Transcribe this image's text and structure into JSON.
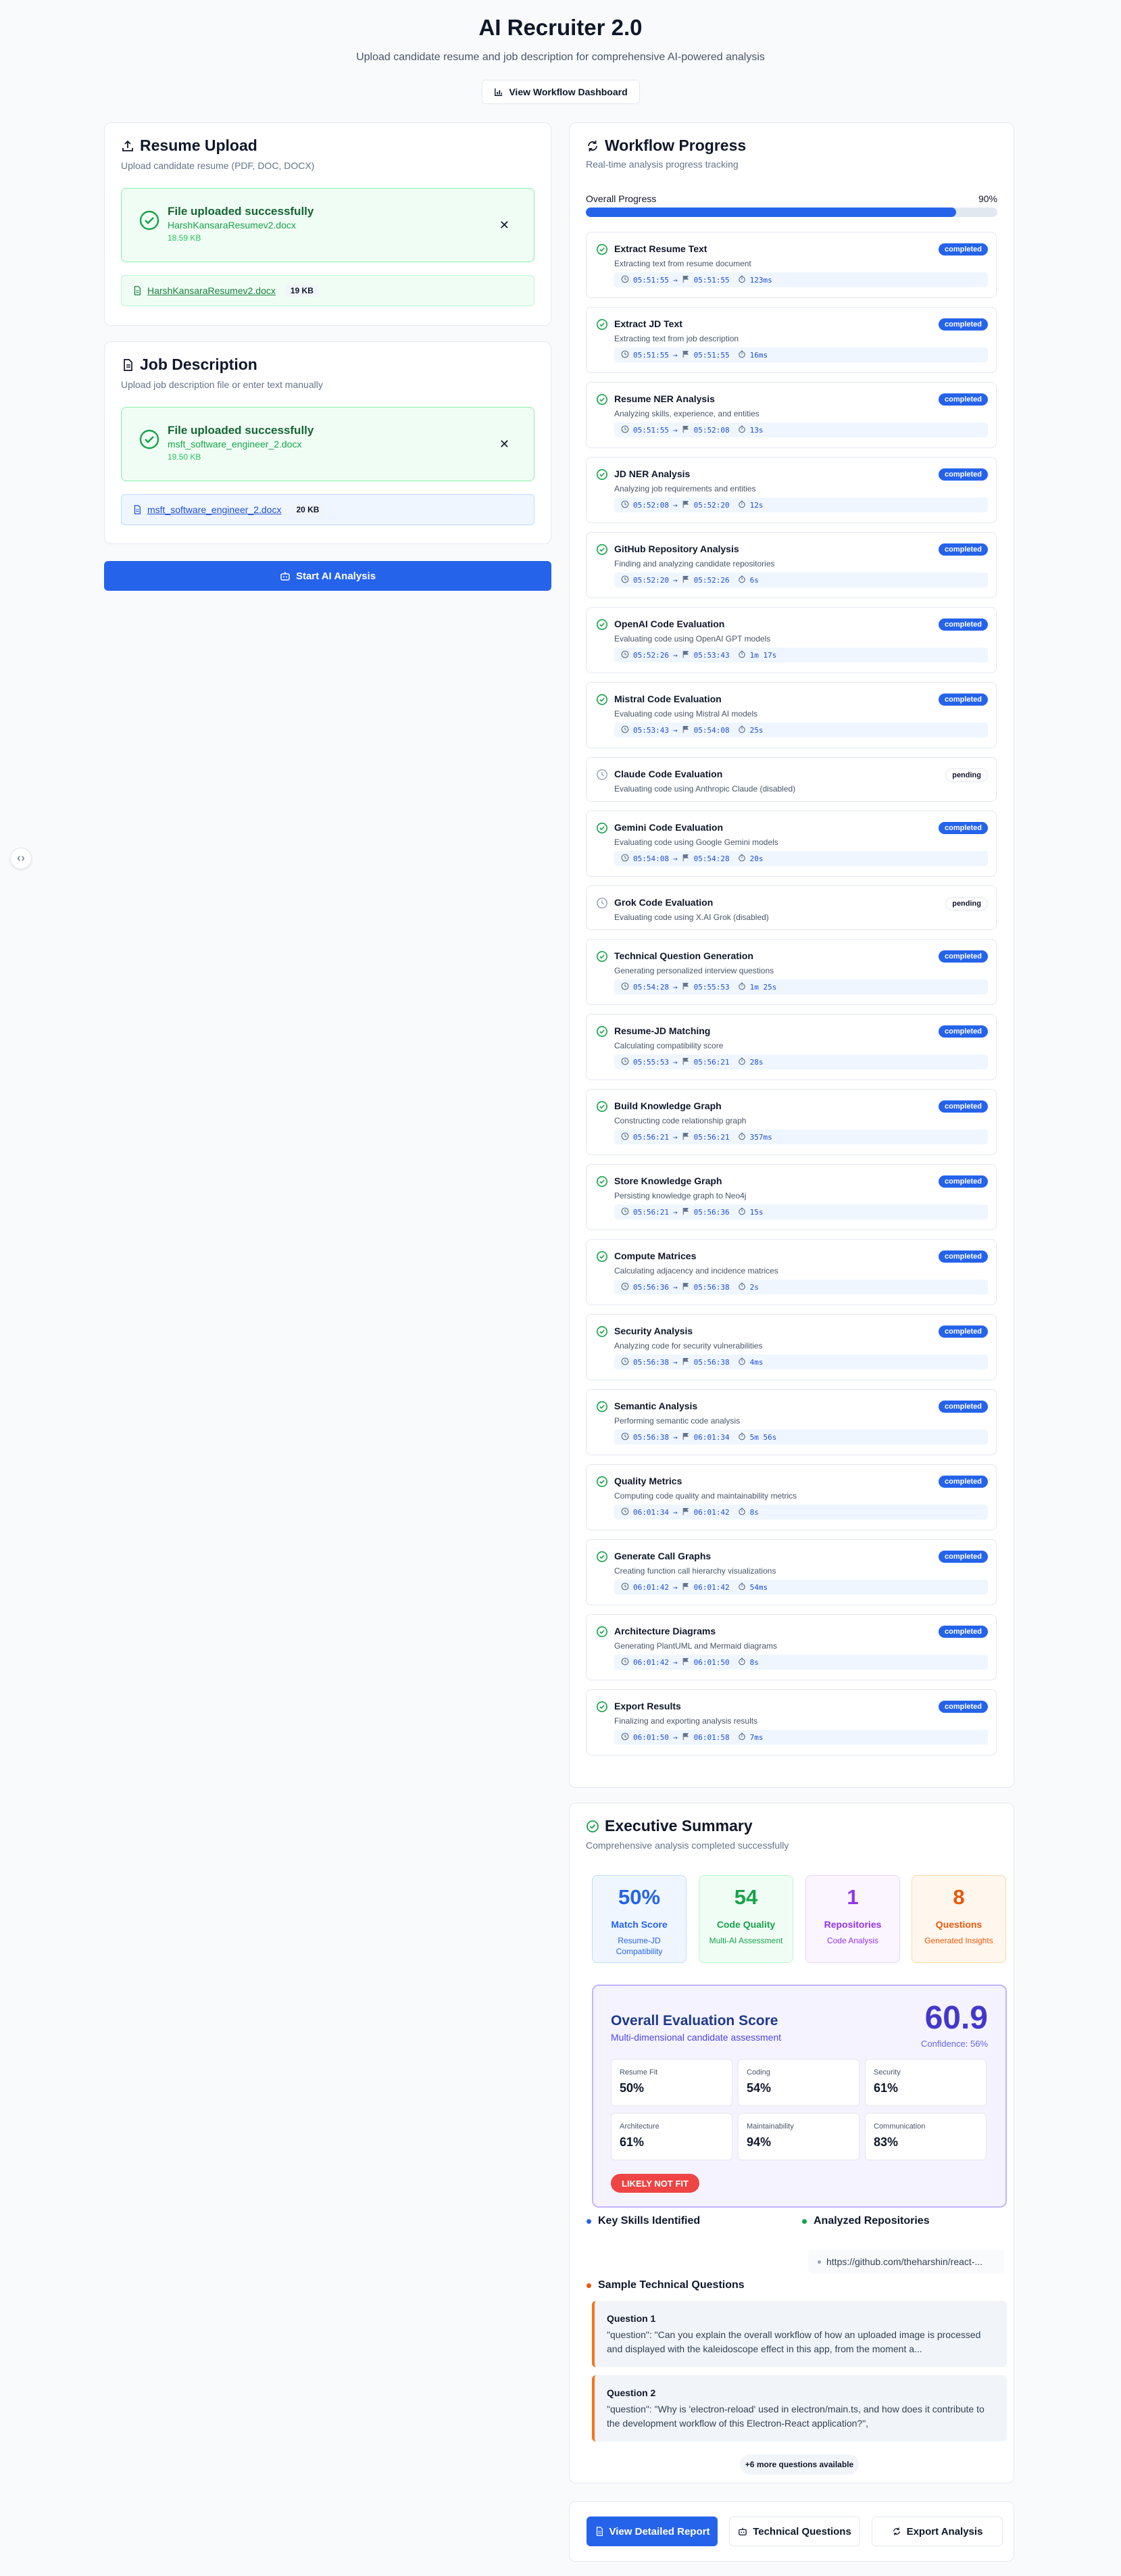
{
  "header": {
    "title": "AI Recruiter 2.0",
    "subtitle": "Upload candidate resume and job description for comprehensive AI-powered analysis",
    "dashboard_button": "View Workflow Dashboard"
  },
  "resume_upload": {
    "title": "Resume Upload",
    "subtitle": "Upload candidate resume (PDF, DOC, DOCX)",
    "success_title": "File uploaded successfully",
    "file_name": "HarshKansaraResumev2.docx",
    "file_size": "18.59 KB",
    "file_row_name": "HarshKansaraResumev2.docx",
    "file_row_size": "19 KB"
  },
  "job_description": {
    "title": "Job Description",
    "subtitle": "Upload job description file or enter text manually",
    "success_title": "File uploaded successfully",
    "file_name": "msft_software_engineer_2.docx",
    "file_size": "19.50 KB",
    "file_row_name": "msft_software_engineer_2.docx",
    "file_row_size": "20 KB"
  },
  "start_button": "Start AI Analysis",
  "workflow": {
    "title": "Workflow Progress",
    "subtitle": "Real-time analysis progress tracking",
    "overall_label": "Overall Progress",
    "overall_percent_text": "90%",
    "overall_percent": 0.9,
    "arrow": "→",
    "steps": [
      {
        "name": "Extract Resume Text",
        "desc": "Extracting text from resume document",
        "status": "completed",
        "start": "05:51:55",
        "end": "05:51:55",
        "duration": "123ms"
      },
      {
        "name": "Extract JD Text",
        "desc": "Extracting text from job description",
        "status": "completed",
        "start": "05:51:55",
        "end": "05:51:55",
        "duration": "16ms"
      },
      {
        "name": "Resume NER Analysis",
        "desc": "Analyzing skills, experience, and entities",
        "status": "completed",
        "start": "05:51:55",
        "end": "05:52:08",
        "duration": "13s"
      },
      {
        "name": "JD NER Analysis",
        "desc": "Analyzing job requirements and entities",
        "status": "completed",
        "start": "05:52:08",
        "end": "05:52:20",
        "duration": "12s"
      },
      {
        "name": "GitHub Repository Analysis",
        "desc": "Finding and analyzing candidate repositories",
        "status": "completed",
        "start": "05:52:20",
        "end": "05:52:26",
        "duration": "6s"
      },
      {
        "name": "OpenAI Code Evaluation",
        "desc": "Evaluating code using OpenAI GPT models",
        "status": "completed",
        "start": "05:52:26",
        "end": "05:53:43",
        "duration": "1m 17s"
      },
      {
        "name": "Mistral Code Evaluation",
        "desc": "Evaluating code using Mistral AI models",
        "status": "completed",
        "start": "05:53:43",
        "end": "05:54:08",
        "duration": "25s"
      },
      {
        "name": "Claude Code Evaluation",
        "desc": "Evaluating code using Anthropic Claude (disabled)",
        "status": "pending"
      },
      {
        "name": "Gemini Code Evaluation",
        "desc": "Evaluating code using Google Gemini models",
        "status": "completed",
        "start": "05:54:08",
        "end": "05:54:28",
        "duration": "20s"
      },
      {
        "name": "Grok Code Evaluation",
        "desc": "Evaluating code using X.AI Grok (disabled)",
        "status": "pending"
      },
      {
        "name": "Technical Question Generation",
        "desc": "Generating personalized interview questions",
        "status": "completed",
        "start": "05:54:28",
        "end": "05:55:53",
        "duration": "1m 25s"
      },
      {
        "name": "Resume-JD Matching",
        "desc": "Calculating compatibility score",
        "status": "completed",
        "start": "05:55:53",
        "end": "05:56:21",
        "duration": "28s"
      },
      {
        "name": "Build Knowledge Graph",
        "desc": "Constructing code relationship graph",
        "status": "completed",
        "start": "05:56:21",
        "end": "05:56:21",
        "duration": "357ms"
      },
      {
        "name": "Store Knowledge Graph",
        "desc": "Persisting knowledge graph to Neo4j",
        "status": "completed",
        "start": "05:56:21",
        "end": "05:56:36",
        "duration": "15s"
      },
      {
        "name": "Compute Matrices",
        "desc": "Calculating adjacency and incidence matrices",
        "status": "completed",
        "start": "05:56:36",
        "end": "05:56:38",
        "duration": "2s"
      },
      {
        "name": "Security Analysis",
        "desc": "Analyzing code for security vulnerabilities",
        "status": "completed",
        "start": "05:56:38",
        "end": "05:56:38",
        "duration": "4ms"
      },
      {
        "name": "Semantic Analysis",
        "desc": "Performing semantic code analysis",
        "status": "completed",
        "start": "05:56:38",
        "end": "06:01:34",
        "duration": "5m 56s"
      },
      {
        "name": "Quality Metrics",
        "desc": "Computing code quality and maintainability metrics",
        "status": "completed",
        "start": "06:01:34",
        "end": "06:01:42",
        "duration": "8s"
      },
      {
        "name": "Generate Call Graphs",
        "desc": "Creating function call hierarchy visualizations",
        "status": "completed",
        "start": "06:01:42",
        "end": "06:01:42",
        "duration": "54ms"
      },
      {
        "name": "Architecture Diagrams",
        "desc": "Generating PlantUML and Mermaid diagrams",
        "status": "completed",
        "start": "06:01:42",
        "end": "06:01:50",
        "duration": "8s"
      },
      {
        "name": "Export Results",
        "desc": "Finalizing and exporting analysis results",
        "status": "completed",
        "start": "06:01:50",
        "end": "06:01:58",
        "duration": "7ms"
      }
    ]
  },
  "summary": {
    "title": "Executive Summary",
    "subtitle": "Comprehensive analysis completed successfully",
    "metrics": [
      {
        "value": "50%",
        "label": "Match Score",
        "sub": "Resume-JD Compatibility",
        "bg": "#eff6ff",
        "border": "#bfdbfe",
        "color": "#2563eb"
      },
      {
        "value": "54",
        "label": "Code Quality",
        "sub": "Multi-AI Assessment",
        "bg": "#f0fdf4",
        "border": "#bbf7d0",
        "color": "#16a34a"
      },
      {
        "value": "1",
        "label": "Repositories",
        "sub": "Code Analysis",
        "bg": "#faf5ff",
        "border": "#e9d5ff",
        "color": "#9333ea"
      },
      {
        "value": "8",
        "label": "Questions",
        "sub": "Generated Insights",
        "bg": "#fff7ed",
        "border": "#fed7aa",
        "color": "#ea580c"
      }
    ],
    "evaluation": {
      "title": "Overall Evaluation Score",
      "subtitle": "Multi-dimensional candidate assessment",
      "score": "60.9",
      "confidence": "Confidence: 56%",
      "subscores": [
        {
          "label": "Resume Fit",
          "value": "50%"
        },
        {
          "label": "Coding",
          "value": "54%"
        },
        {
          "label": "Security",
          "value": "61%"
        },
        {
          "label": "Architecture",
          "value": "61%"
        },
        {
          "label": "Maintainability",
          "value": "94%"
        },
        {
          "label": "Communication",
          "value": "83%"
        }
      ],
      "verdict": "LIKELY NOT FIT"
    },
    "skills_title": "Key Skills Identified",
    "repos_title": "Analyzed Repositories",
    "repo_url": "https://github.com/theharshin/react-...",
    "questions_title": "Sample Technical Questions",
    "questions": [
      {
        "title": "Question 1",
        "text": "\"question\": \"Can you explain the overall workflow of how an uploaded image is processed and displayed with the kaleidoscope effect in this app, from the moment a..."
      },
      {
        "title": "Question 2",
        "text": "\"question\": \"Why is 'electron-reload' used in electron/main.ts, and how does it contribute to the development workflow of this Electron-React application?\","
      }
    ],
    "more_questions": "+6 more questions available",
    "actions": {
      "report": "View Detailed Report",
      "questions": "Technical Questions",
      "export": "Export Analysis"
    }
  }
}
